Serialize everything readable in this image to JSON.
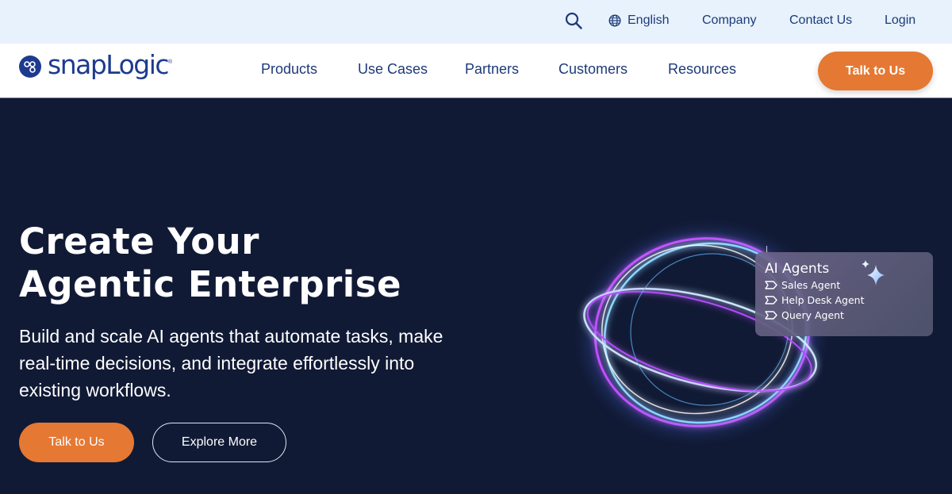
{
  "utility_bar": {
    "search_icon": "search-icon",
    "language": {
      "icon": "globe-icon",
      "label": "English"
    },
    "links": [
      "Company",
      "Contact Us",
      "Login"
    ]
  },
  "header": {
    "logo": {
      "text": "snapLogic",
      "reg": "®"
    },
    "nav": [
      "Products",
      "Use Cases",
      "Partners",
      "Customers",
      "Resources"
    ],
    "cta_label": "Talk to Us"
  },
  "hero": {
    "title_line1": "Create Your",
    "title_line2": "Agentic Enterprise",
    "subtitle": "Build and scale AI agents that automate tasks, make real-time decisions, and integrate effortlessly into existing workflows.",
    "primary_button": "Talk to Us",
    "secondary_button": "Explore More",
    "agents_card": {
      "title": "AI Agents",
      "items": [
        "Sales Agent",
        "Help Desk Agent",
        "Query Agent"
      ]
    }
  },
  "colors": {
    "accent": "#e57833",
    "brand": "#1d3a8e",
    "utility_bg": "#e7f2fd",
    "hero_bg": "#111a35"
  }
}
